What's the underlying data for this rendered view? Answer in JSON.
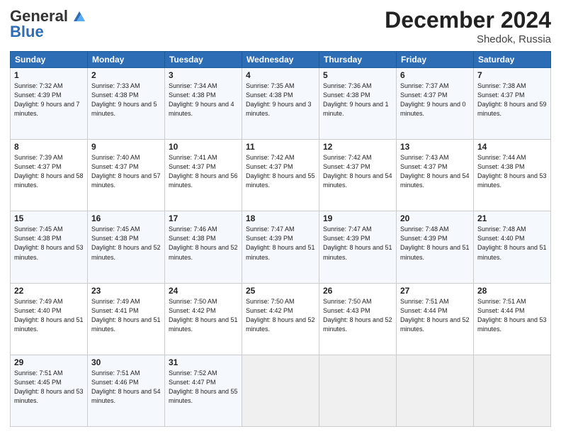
{
  "header": {
    "logo_line1": "General",
    "logo_line2": "Blue",
    "month": "December 2024",
    "location": "Shedok, Russia"
  },
  "weekdays": [
    "Sunday",
    "Monday",
    "Tuesday",
    "Wednesday",
    "Thursday",
    "Friday",
    "Saturday"
  ],
  "weeks": [
    [
      {
        "day": "1",
        "sunrise": "Sunrise: 7:32 AM",
        "sunset": "Sunset: 4:39 PM",
        "daylight": "Daylight: 9 hours and 7 minutes."
      },
      {
        "day": "2",
        "sunrise": "Sunrise: 7:33 AM",
        "sunset": "Sunset: 4:38 PM",
        "daylight": "Daylight: 9 hours and 5 minutes."
      },
      {
        "day": "3",
        "sunrise": "Sunrise: 7:34 AM",
        "sunset": "Sunset: 4:38 PM",
        "daylight": "Daylight: 9 hours and 4 minutes."
      },
      {
        "day": "4",
        "sunrise": "Sunrise: 7:35 AM",
        "sunset": "Sunset: 4:38 PM",
        "daylight": "Daylight: 9 hours and 3 minutes."
      },
      {
        "day": "5",
        "sunrise": "Sunrise: 7:36 AM",
        "sunset": "Sunset: 4:38 PM",
        "daylight": "Daylight: 9 hours and 1 minute."
      },
      {
        "day": "6",
        "sunrise": "Sunrise: 7:37 AM",
        "sunset": "Sunset: 4:37 PM",
        "daylight": "Daylight: 9 hours and 0 minutes."
      },
      {
        "day": "7",
        "sunrise": "Sunrise: 7:38 AM",
        "sunset": "Sunset: 4:37 PM",
        "daylight": "Daylight: 8 hours and 59 minutes."
      }
    ],
    [
      {
        "day": "8",
        "sunrise": "Sunrise: 7:39 AM",
        "sunset": "Sunset: 4:37 PM",
        "daylight": "Daylight: 8 hours and 58 minutes."
      },
      {
        "day": "9",
        "sunrise": "Sunrise: 7:40 AM",
        "sunset": "Sunset: 4:37 PM",
        "daylight": "Daylight: 8 hours and 57 minutes."
      },
      {
        "day": "10",
        "sunrise": "Sunrise: 7:41 AM",
        "sunset": "Sunset: 4:37 PM",
        "daylight": "Daylight: 8 hours and 56 minutes."
      },
      {
        "day": "11",
        "sunrise": "Sunrise: 7:42 AM",
        "sunset": "Sunset: 4:37 PM",
        "daylight": "Daylight: 8 hours and 55 minutes."
      },
      {
        "day": "12",
        "sunrise": "Sunrise: 7:42 AM",
        "sunset": "Sunset: 4:37 PM",
        "daylight": "Daylight: 8 hours and 54 minutes."
      },
      {
        "day": "13",
        "sunrise": "Sunrise: 7:43 AM",
        "sunset": "Sunset: 4:37 PM",
        "daylight": "Daylight: 8 hours and 54 minutes."
      },
      {
        "day": "14",
        "sunrise": "Sunrise: 7:44 AM",
        "sunset": "Sunset: 4:38 PM",
        "daylight": "Daylight: 8 hours and 53 minutes."
      }
    ],
    [
      {
        "day": "15",
        "sunrise": "Sunrise: 7:45 AM",
        "sunset": "Sunset: 4:38 PM",
        "daylight": "Daylight: 8 hours and 53 minutes."
      },
      {
        "day": "16",
        "sunrise": "Sunrise: 7:45 AM",
        "sunset": "Sunset: 4:38 PM",
        "daylight": "Daylight: 8 hours and 52 minutes."
      },
      {
        "day": "17",
        "sunrise": "Sunrise: 7:46 AM",
        "sunset": "Sunset: 4:38 PM",
        "daylight": "Daylight: 8 hours and 52 minutes."
      },
      {
        "day": "18",
        "sunrise": "Sunrise: 7:47 AM",
        "sunset": "Sunset: 4:39 PM",
        "daylight": "Daylight: 8 hours and 51 minutes."
      },
      {
        "day": "19",
        "sunrise": "Sunrise: 7:47 AM",
        "sunset": "Sunset: 4:39 PM",
        "daylight": "Daylight: 8 hours and 51 minutes."
      },
      {
        "day": "20",
        "sunrise": "Sunrise: 7:48 AM",
        "sunset": "Sunset: 4:39 PM",
        "daylight": "Daylight: 8 hours and 51 minutes."
      },
      {
        "day": "21",
        "sunrise": "Sunrise: 7:48 AM",
        "sunset": "Sunset: 4:40 PM",
        "daylight": "Daylight: 8 hours and 51 minutes."
      }
    ],
    [
      {
        "day": "22",
        "sunrise": "Sunrise: 7:49 AM",
        "sunset": "Sunset: 4:40 PM",
        "daylight": "Daylight: 8 hours and 51 minutes."
      },
      {
        "day": "23",
        "sunrise": "Sunrise: 7:49 AM",
        "sunset": "Sunset: 4:41 PM",
        "daylight": "Daylight: 8 hours and 51 minutes."
      },
      {
        "day": "24",
        "sunrise": "Sunrise: 7:50 AM",
        "sunset": "Sunset: 4:42 PM",
        "daylight": "Daylight: 8 hours and 51 minutes."
      },
      {
        "day": "25",
        "sunrise": "Sunrise: 7:50 AM",
        "sunset": "Sunset: 4:42 PM",
        "daylight": "Daylight: 8 hours and 52 minutes."
      },
      {
        "day": "26",
        "sunrise": "Sunrise: 7:50 AM",
        "sunset": "Sunset: 4:43 PM",
        "daylight": "Daylight: 8 hours and 52 minutes."
      },
      {
        "day": "27",
        "sunrise": "Sunrise: 7:51 AM",
        "sunset": "Sunset: 4:44 PM",
        "daylight": "Daylight: 8 hours and 52 minutes."
      },
      {
        "day": "28",
        "sunrise": "Sunrise: 7:51 AM",
        "sunset": "Sunset: 4:44 PM",
        "daylight": "Daylight: 8 hours and 53 minutes."
      }
    ],
    [
      {
        "day": "29",
        "sunrise": "Sunrise: 7:51 AM",
        "sunset": "Sunset: 4:45 PM",
        "daylight": "Daylight: 8 hours and 53 minutes."
      },
      {
        "day": "30",
        "sunrise": "Sunrise: 7:51 AM",
        "sunset": "Sunset: 4:46 PM",
        "daylight": "Daylight: 8 hours and 54 minutes."
      },
      {
        "day": "31",
        "sunrise": "Sunrise: 7:52 AM",
        "sunset": "Sunset: 4:47 PM",
        "daylight": "Daylight: 8 hours and 55 minutes."
      },
      null,
      null,
      null,
      null
    ]
  ]
}
